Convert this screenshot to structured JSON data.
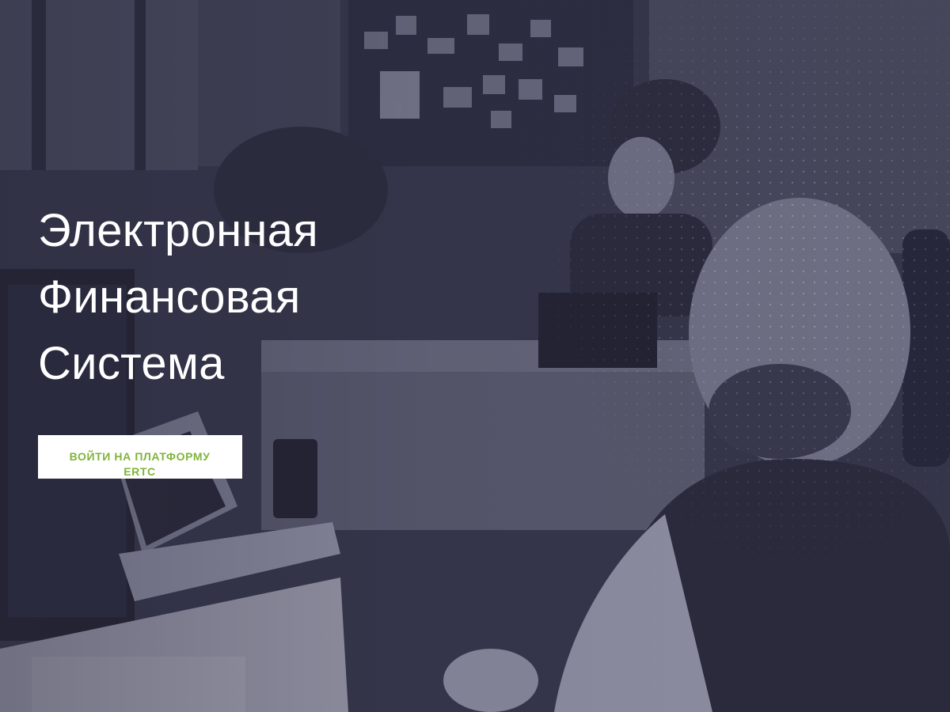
{
  "hero": {
    "title_lines": [
      "Электронная",
      "Финансовая",
      "Система"
    ],
    "cta_label": "ВОЙТИ НА ПЛАТФОРМУ ERTC",
    "background_image": "office-photo"
  },
  "colors": {
    "overlay": "#34344a",
    "title_text": "#ffffff",
    "cta_background": "#ffffff",
    "cta_text": "#7fb43a"
  }
}
